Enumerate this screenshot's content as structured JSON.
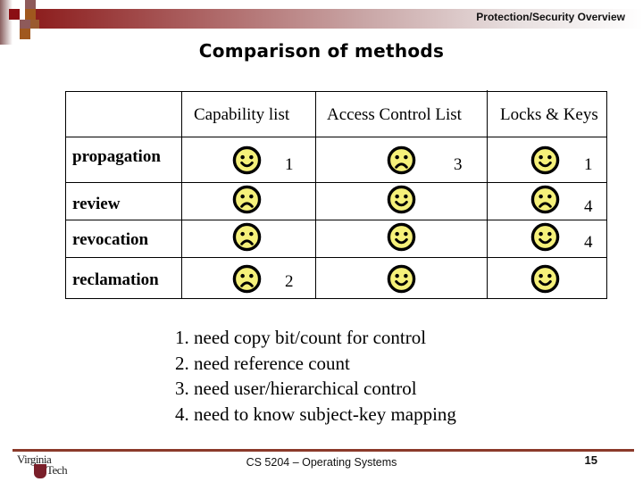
{
  "header": {
    "section_title": "Protection/Security Overview",
    "brand_colors": {
      "primary": "#8b1a1a",
      "accent": "#8b4513"
    }
  },
  "slide": {
    "title": "Comparison of methods"
  },
  "table": {
    "columns": [
      "",
      "Capability list",
      "Access Control List",
      "Locks & Keys"
    ],
    "rows": [
      {
        "label": "propagation",
        "cells": [
          {
            "face": "happy",
            "note": "1"
          },
          {
            "face": "sad",
            "note": "3"
          },
          {
            "face": "happy",
            "note": "1"
          }
        ]
      },
      {
        "label": "review",
        "cells": [
          {
            "face": "sad",
            "note": ""
          },
          {
            "face": "happy",
            "note": ""
          },
          {
            "face": "sad",
            "note": "4"
          }
        ]
      },
      {
        "label": "revocation",
        "cells": [
          {
            "face": "sad",
            "note": ""
          },
          {
            "face": "happy",
            "note": ""
          },
          {
            "face": "happy",
            "note": "4"
          }
        ]
      },
      {
        "label": "reclamation",
        "cells": [
          {
            "face": "sad",
            "note": "2"
          },
          {
            "face": "happy",
            "note": ""
          },
          {
            "face": "happy",
            "note": ""
          }
        ]
      }
    ],
    "face_color": "#f5f07a"
  },
  "notes": [
    "1. need copy bit/count for control",
    "2. need reference count",
    "3. need user/hierarchical control",
    "4. need to know subject-key mapping"
  ],
  "footer": {
    "logo_top": "Virginia",
    "logo_bottom": "Tech",
    "course": "CS 5204 – Operating Systems",
    "page_number": "15"
  }
}
